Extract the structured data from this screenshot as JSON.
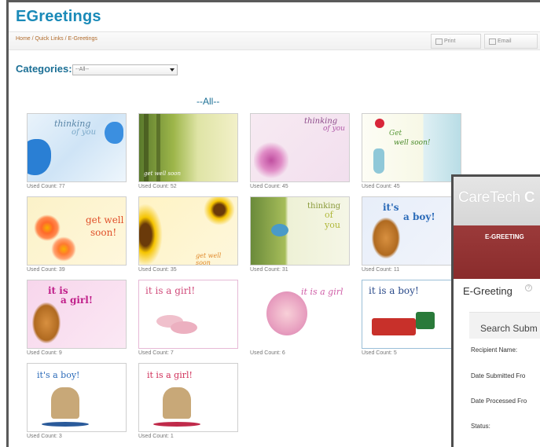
{
  "page": {
    "title": "EGreetings",
    "breadcrumb": "Home / Quick Links / E-Greetings",
    "print_label": "Print",
    "email_label": "Email"
  },
  "categories": {
    "label": "Categories:",
    "selected": "--All--"
  },
  "section_title": "--All--",
  "cards": [
    {
      "art": "thinking-of-you-butterflies",
      "text1": "thinking",
      "text2": "of you",
      "count": "Used Count: 77"
    },
    {
      "art": "forest-get-well-soon",
      "text1": "get well soon",
      "text2": "",
      "count": "Used Count: 52"
    },
    {
      "art": "thinking-of-you-orchids",
      "text1": "thinking",
      "text2": "of you",
      "count": "Used Count: 45"
    },
    {
      "art": "get-well-soon-vase",
      "text1": "Get",
      "text2": "well soon!",
      "count": "Used Count: 45"
    },
    {
      "art": "get-well-soon-daisies",
      "text1": "get well",
      "text2": "soon!",
      "count": "Used Count: 39"
    },
    {
      "art": "sunflowers-get-well-soon",
      "text1": "get well soon",
      "text2": "",
      "count": "Used Count: 35"
    },
    {
      "art": "thinking-of-you-bird",
      "text1": "thinking",
      "text2": "of you",
      "count": "Used Count: 31"
    },
    {
      "art": "its-a-boy-bear",
      "text1": "it's",
      "text2": "a boy!",
      "count": "Used Count: 11"
    },
    {
      "art": "it-is-a-girl-bear",
      "text1": "it is",
      "text2": "a girl!",
      "count": "Used Count: 9"
    },
    {
      "art": "it-is-a-girl-shoes",
      "text1": "it is a girl!",
      "text2": "",
      "count": "Used Count: 7"
    },
    {
      "art": "it-is-a-girl-baby",
      "text1": "it is a girl",
      "text2": "",
      "count": "Used Count: 6"
    },
    {
      "art": "it-is-a-boy-train",
      "text1": "it is a boy!",
      "text2": "",
      "count": "Used Count: 5"
    },
    {
      "art": "its-a-boy-rocking-horse",
      "text1": "it's a boy!",
      "text2": "",
      "count": "Used Count: 3"
    },
    {
      "art": "it-is-a-girl-rocking-horse",
      "text1": "it is a girl!",
      "text2": "",
      "count": "Used Count: 1"
    }
  ],
  "overlay": {
    "brand": "CareTech",
    "brand_cut": "C",
    "nav_tab": "E-GREETING",
    "title": "E-Greeting",
    "help": "?",
    "search_header": "Search Subm",
    "fields": [
      "Recipient Name:",
      "Date Submitted Fro",
      "Date Processed Fro",
      "Status:"
    ]
  },
  "colors": {
    "title_blue": "#1a8ab8",
    "label_blue": "#1b6f95",
    "nav_red": "#8a2c2c"
  }
}
